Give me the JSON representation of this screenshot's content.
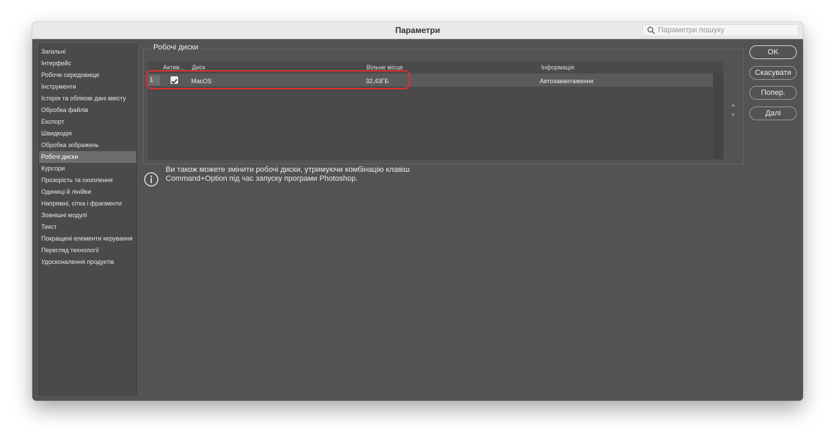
{
  "window": {
    "title": "Параметри"
  },
  "search": {
    "placeholder": "Параметри пошуку"
  },
  "sidebar": {
    "items": [
      {
        "label": "Загальні"
      },
      {
        "label": "Інтерфейс"
      },
      {
        "label": "Робоче середовище"
      },
      {
        "label": "Інструменти"
      },
      {
        "label": "Історія та облікові дані вмісту"
      },
      {
        "label": "Обробка файлів"
      },
      {
        "label": "Експорт"
      },
      {
        "label": "Швидкодія"
      },
      {
        "label": "Обробка зображень"
      },
      {
        "label": "Робочі диски",
        "active": true
      },
      {
        "label": "Курсори"
      },
      {
        "label": "Прозорість та охоплення"
      },
      {
        "label": "Одиниці й лінійки"
      },
      {
        "label": "Напрямні, сітка і фрагменти"
      },
      {
        "label": "Зовнішні модулі"
      },
      {
        "label": "Текст"
      },
      {
        "label": "Покращені елементи керування"
      },
      {
        "label": "Перегляд технології"
      },
      {
        "label": "Удосконалення продуктів"
      }
    ]
  },
  "scratch": {
    "title": "Робочі диски",
    "columns": {
      "active": "Актив...",
      "disk": "Диск",
      "free": "Вільне місце",
      "info": "Інформація"
    },
    "rows": [
      {
        "num": "1",
        "checked": true,
        "disk": "MacOS",
        "free": "32,43ГБ",
        "info": "Автозавантаження"
      }
    ]
  },
  "info": {
    "line1": "Ви також можете змінити робочі диски, утримуючи комбінацію клавіш",
    "line2": "Command+Option під час запуску програми Photoshop."
  },
  "buttons": {
    "ok": "OK",
    "cancel": "Скасувати",
    "prev": "Попер.",
    "next": "Далі"
  },
  "arrows": {
    "up": "▲",
    "down": "▼"
  },
  "colors": {
    "highlight": "#e0312b",
    "window_bg": "#535353"
  }
}
